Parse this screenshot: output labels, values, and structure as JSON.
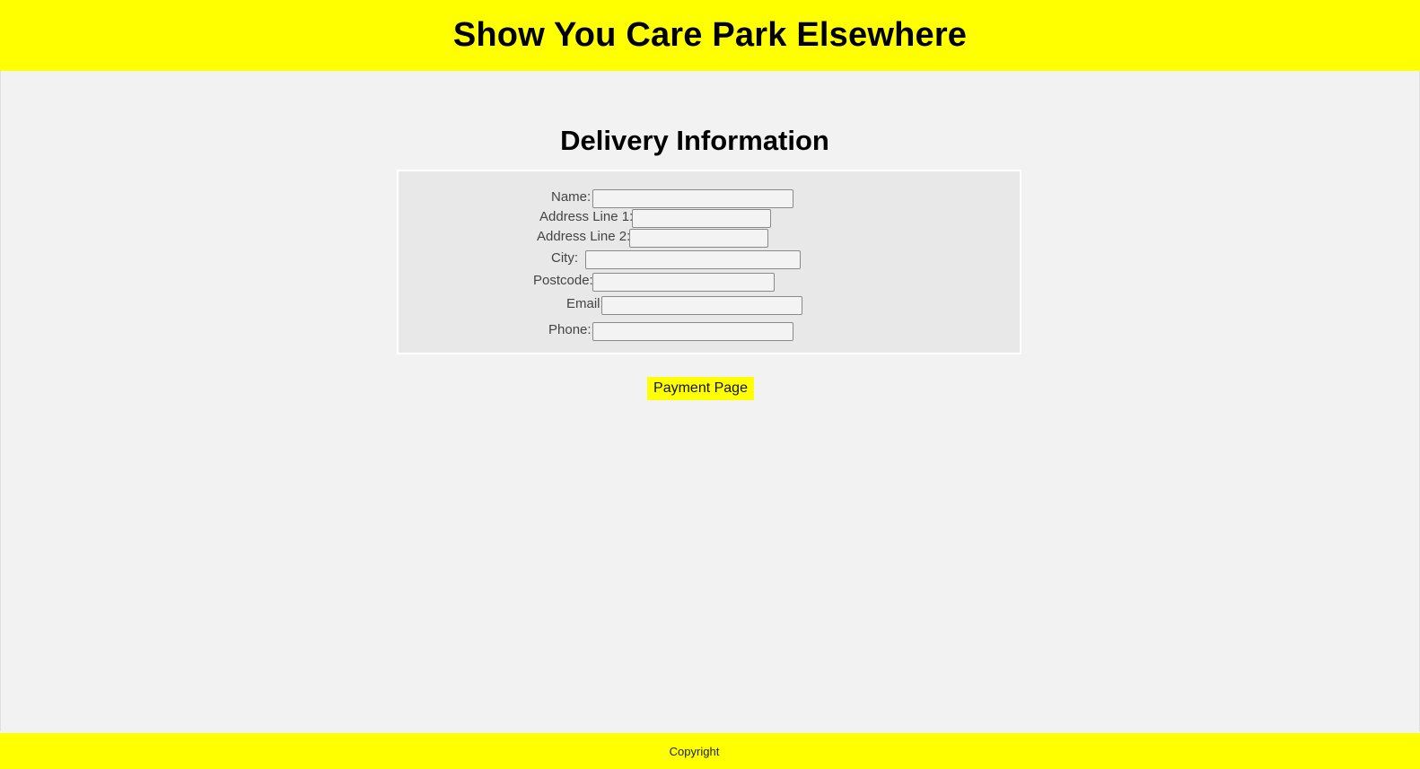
{
  "header": {
    "title": "Show You Care Park Elsewhere",
    "background": "#ffff00"
  },
  "delivery": {
    "heading": "Delivery Information",
    "fields": {
      "name": {
        "label": "Name:",
        "value": ""
      },
      "address1": {
        "label": "Address Line 1:",
        "value": ""
      },
      "address2": {
        "label": "Address Line 2:",
        "value": ""
      },
      "city": {
        "label": "City:",
        "value": ""
      },
      "postcode": {
        "label": "Postcode:",
        "value": ""
      },
      "email": {
        "label": "Email:",
        "value": ""
      },
      "phone": {
        "label": "Phone:",
        "value": ""
      }
    },
    "submit_label": "Payment Page"
  },
  "footer": {
    "text": "Copyright",
    "background": "#ffff00"
  }
}
